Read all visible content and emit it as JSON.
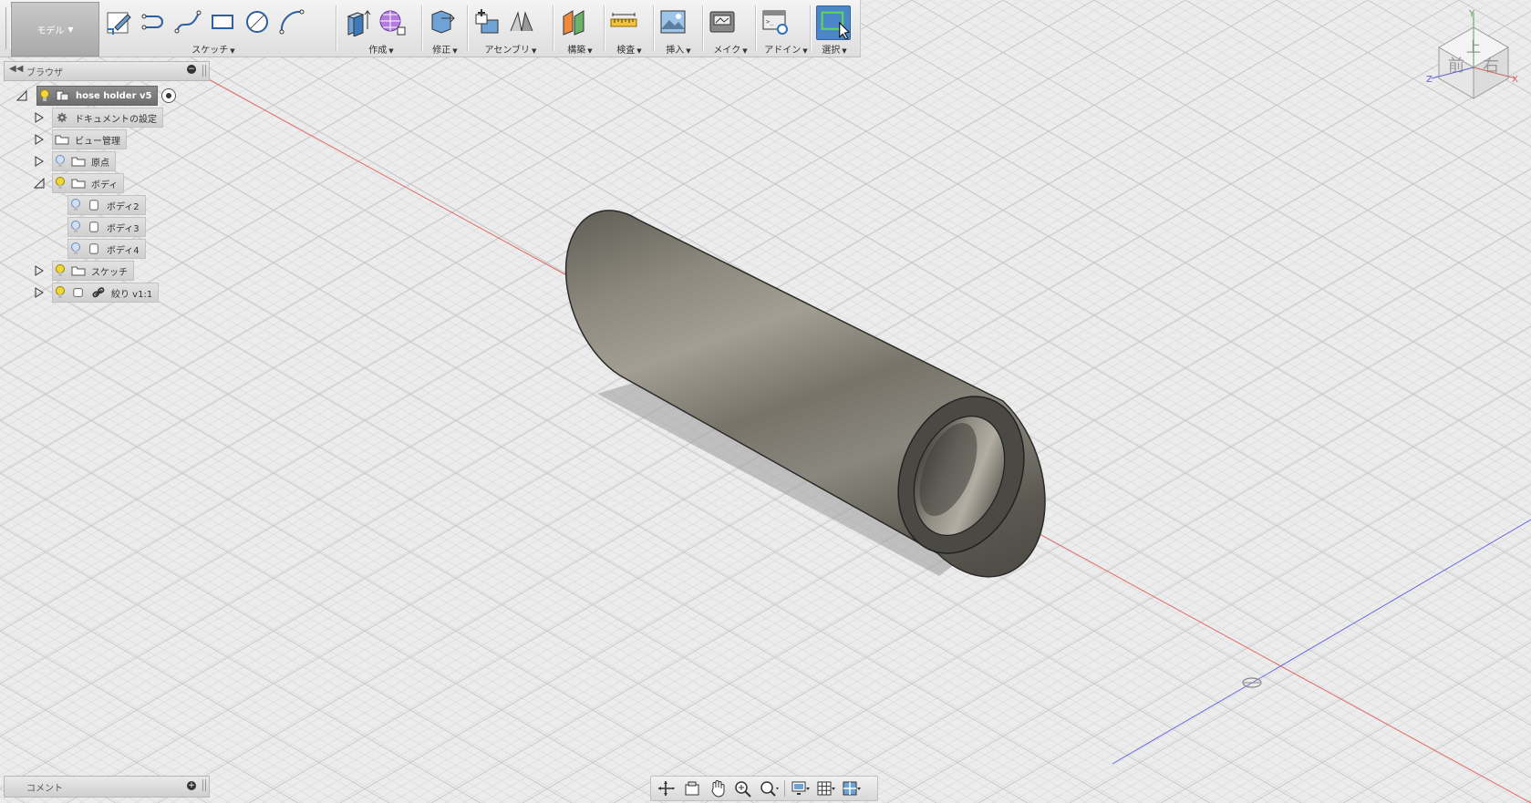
{
  "toolbar": {
    "workspace": "モデル",
    "groups": [
      {
        "label": "スケッチ"
      },
      {
        "label": "作成"
      },
      {
        "label": "修正"
      },
      {
        "label": "アセンブリ"
      },
      {
        "label": "構築"
      },
      {
        "label": "検査"
      },
      {
        "label": "挿入"
      },
      {
        "label": "メイク"
      },
      {
        "label": "アドイン"
      },
      {
        "label": "選択"
      }
    ]
  },
  "browser": {
    "title": "ブラウザ",
    "root": "hose holder v5",
    "items": [
      {
        "label": "ドキュメントの設定"
      },
      {
        "label": "ビュー管理"
      },
      {
        "label": "原点"
      },
      {
        "label": "ボディ"
      },
      {
        "label": "ボディ2"
      },
      {
        "label": "ボディ3"
      },
      {
        "label": "ボディ4"
      },
      {
        "label": "スケッチ"
      },
      {
        "label": "絞り v1:1"
      }
    ]
  },
  "comment": {
    "title": "コメント"
  },
  "viewcube": {
    "top": "上",
    "front": "前",
    "right": "右",
    "axis_x": "X",
    "axis_y": "Y",
    "axis_z": "Z"
  },
  "colors": {
    "accent": "#4b86c9",
    "x_axis": "#e06060",
    "z_axis": "#5a5adc",
    "bulb": "#f2d63a"
  }
}
